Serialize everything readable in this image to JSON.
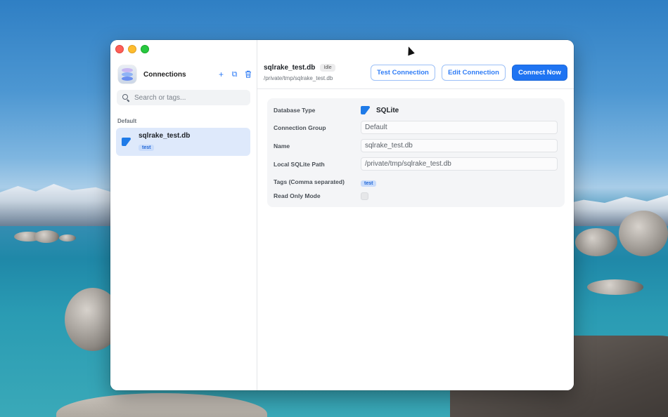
{
  "sidebar": {
    "title": "Connections",
    "actions": {
      "add": "+",
      "copy": "⧉",
      "delete": "🗑"
    },
    "search": {
      "placeholder": "Search or tags..."
    },
    "group_label": "Default",
    "connections": [
      {
        "name": "sqlrake_test.db",
        "tag": "test",
        "icon": "sqlite-icon"
      }
    ]
  },
  "header": {
    "title": "sqlrake_test.db",
    "status": "Idle",
    "path": "/private/tmp/sqlrake_test.db"
  },
  "toolbar": {
    "test_label": "Test Connection",
    "edit_label": "Edit Connection",
    "connect_label": "Connect Now"
  },
  "form": {
    "database_type": {
      "label": "Database Type",
      "value": "SQLite"
    },
    "connection_group": {
      "label": "Connection Group",
      "value": "Default"
    },
    "name": {
      "label": "Name",
      "value": "sqlrake_test.db"
    },
    "local_path": {
      "label": "Local SQLite Path",
      "value": "/private/tmp/sqlrake_test.db"
    },
    "tags": {
      "label": "Tags (Comma separated)",
      "value": "test"
    },
    "read_only": {
      "label": "Read Only Mode",
      "checked": false
    }
  },
  "colors": {
    "accent": "#1f74f2",
    "selected_bg": "#dee9fb"
  }
}
